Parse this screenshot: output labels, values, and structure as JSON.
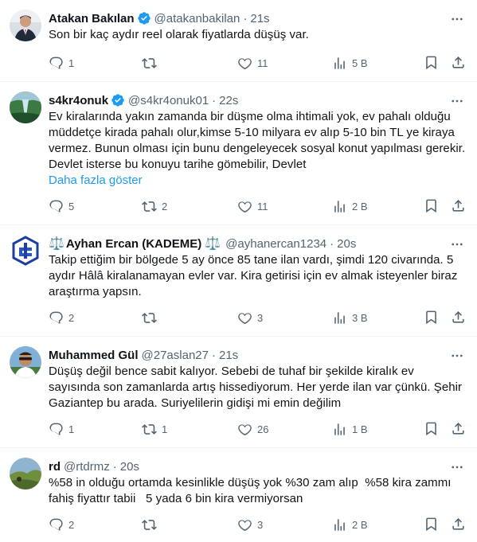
{
  "tweets": [
    {
      "name": "Atakan Bakılan",
      "handle": "@atakanbakilan",
      "time": "21s",
      "verified": true,
      "text": "Son bir kaç aydır reel olarak fiyatlarda düşüş var.",
      "show_more": "",
      "replies": "1",
      "retweets": "",
      "likes": "11",
      "views": "5 B"
    },
    {
      "name": "s4kr4onuk",
      "handle": "@s4kr4onuk01",
      "time": "22s",
      "verified": true,
      "text": "Ev kiralarında yakın zamanda bir düşme olma ihtimali yok, ev pahalı olduğu müddetçe kirada pahalı olur,kimse 5-10 milyara ev alıp 5-10 bin TL ye kiraya vermez. Bunun olması için bunu dengeleyecek sosyal konut yapılması gerekir. Devlet isterse bu konuyu tarihe gömebilir, Devlet",
      "show_more": "Daha fazla göster",
      "replies": "5",
      "retweets": "2",
      "likes": "11",
      "views": "2 B"
    },
    {
      "name": "Ayhan Ercan (KADEME)",
      "name_prefix": "⚖️",
      "name_suffix": "⚖️",
      "handle": "@ayhanercan1234",
      "time": "20s",
      "verified": false,
      "text": "Takip ettiğim bir bölgede 5 ay önce 85 tane ilan vardı, şimdi 120 civarında. 5 aydır Hâlâ kiralanamayan evler var. Kira getirisi için ev almak isteyenler biraz araştırma yapsın.",
      "show_more": "",
      "replies": "2",
      "retweets": "",
      "likes": "3",
      "views": "3 B"
    },
    {
      "name": "Muhammed Gül",
      "handle": "@27aslan27",
      "time": "21s",
      "verified": false,
      "text": "Düşüş değil bence sabit kalıyor. Sebebi de tuhaf bir şekilde kiralık ev sayısında son zamanlarda artış hissediyorum. Her yerde ilan var çünkü. Şehir Gaziantep bu arada. Suriyelilerin gidişi mi emin değilim",
      "show_more": "",
      "replies": "1",
      "retweets": "1",
      "likes": "26",
      "views": "1 B"
    },
    {
      "name": "rd",
      "handle": "@rtdrmz",
      "time": "20s",
      "verified": false,
      "text": "%58 in olduğu ortamda kesinlikle düşüş yok %30 zam alıp  %58 kira zammı fahiş fiyattır tabii   5 yada 6 bin kira vermiyorsan",
      "show_more": "",
      "replies": "2",
      "retweets": "",
      "likes": "3",
      "views": "2 B"
    }
  ],
  "colors": {
    "accent": "#1d9bf0",
    "muted": "#536471",
    "text": "#0f1419",
    "divider": "#eff3f4"
  }
}
